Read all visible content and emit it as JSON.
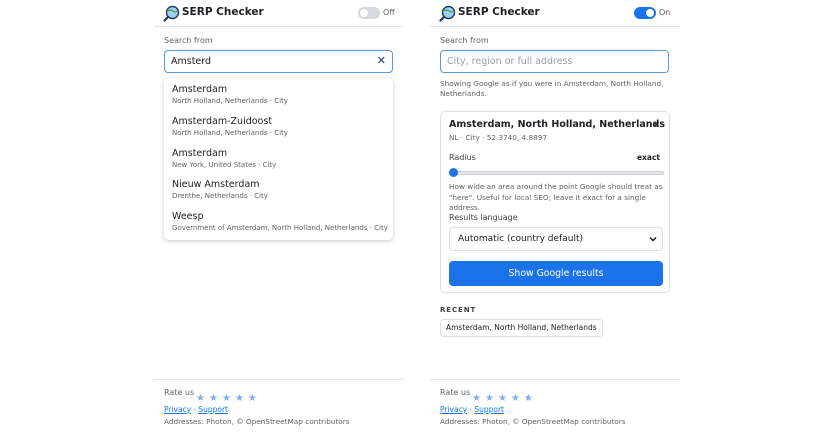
{
  "colors": {
    "accent": "#1a73e8",
    "text": "#202124",
    "muted": "#5f6368",
    "border": "#dde0e3",
    "star": "#7fb0e6"
  },
  "app": {
    "title": "SERP Checker",
    "logo_icon": "magnifier-globe-icon"
  },
  "left_panel": {
    "toggle": {
      "state": "off",
      "label": "Off"
    },
    "search_label": "Search from",
    "search_value": "Amsterd",
    "clear_icon": "close-icon",
    "suggestions": [
      {
        "name": "Amsterdam",
        "detail": "North Holland, Netherlands · City"
      },
      {
        "name": "Amsterdam-Zuidoost",
        "detail": "North Holland, Netherlands · City"
      },
      {
        "name": "Amsterdam",
        "detail": "New York, United States · City"
      },
      {
        "name": "Nieuw Amsterdam",
        "detail": "Drenthe, Netherlands · City"
      },
      {
        "name": "Weesp",
        "detail": "Government of Amsterdam, North Holland, Netherlands · City"
      }
    ]
  },
  "right_panel": {
    "toggle": {
      "state": "on",
      "label": "On"
    },
    "search_label": "Search from",
    "search_placeholder": "City, region or full address",
    "info_text": "Showing Google as if you were in Amsterdam, North Holland, Netherlands.",
    "location_card": {
      "title": "Amsterdam, North Holland, Netherlands",
      "meta": "NL · City · 52.3740, 4.8897",
      "close_icon": "close-icon",
      "radius_label": "Radius",
      "radius_value": "exact",
      "radius_level": 0,
      "radius_help": "How wide an area around the point Google should treat as \"here\". Useful for local SEO; leave it exact for a single address.",
      "language_label": "Results language",
      "language_value": "Automatic (country default)",
      "show_button": "Show Google results"
    },
    "recent_label": "RECENT",
    "recent_items": [
      "Amsterdam, North Holland, Netherlands"
    ]
  },
  "footer": {
    "rate_label": "Rate us",
    "stars": [
      "★",
      "★",
      "★",
      "★",
      "★"
    ],
    "privacy_link": "Privacy",
    "separator": "·",
    "support_link": "Support",
    "attribution": "Addresses: Photon, © OpenStreetMap contributors"
  }
}
